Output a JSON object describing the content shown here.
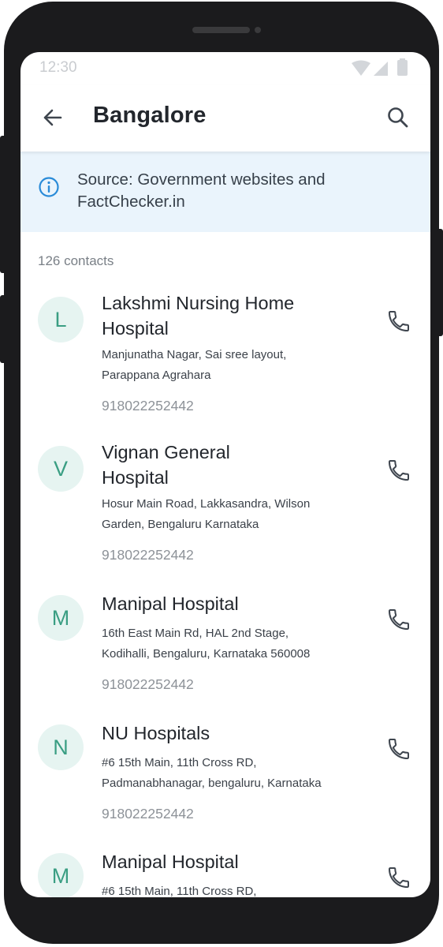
{
  "status_bar": {
    "time": "12:30"
  },
  "header": {
    "title": "Bangalore"
  },
  "banner": {
    "text": "Source: Government websites and FactChecker.in"
  },
  "list": {
    "count_label": "126 contacts",
    "items": [
      {
        "initial": "L",
        "name": "Lakshmi Nursing Home Hospital",
        "address": "Manjunatha Nagar, Sai sree layout, Parappana Agrahara",
        "phone": "918022252442"
      },
      {
        "initial": "V",
        "name": "Vignan General Hospital",
        "address": "Hosur Main Road, Lakkasandra, Wilson Garden, Bengaluru Karnataka",
        "phone": "918022252442"
      },
      {
        "initial": "M",
        "name": "Manipal Hospital",
        "address": "16th East Main Rd, HAL 2nd Stage, Kodihalli, Bengaluru, Karnataka 560008",
        "phone": "918022252442"
      },
      {
        "initial": "N",
        "name": "NU Hospitals",
        "address": "#6 15th Main, 11th Cross RD, Padmanabhanagar, bengaluru, Karnataka",
        "phone": "918022252442"
      },
      {
        "initial": "M",
        "name": "Manipal Hospital",
        "address": "#6 15th Main, 11th Cross RD,",
        "phone": ""
      }
    ]
  },
  "colors": {
    "accent": "#2a8bd8",
    "avatar_bg": "#e6f4f1",
    "avatar_text": "#3a9e83",
    "banner_bg": "#eaf4fc"
  },
  "icons": {
    "back": "arrow-left-icon",
    "search": "search-icon",
    "info": "info-icon",
    "call": "phone-icon"
  }
}
